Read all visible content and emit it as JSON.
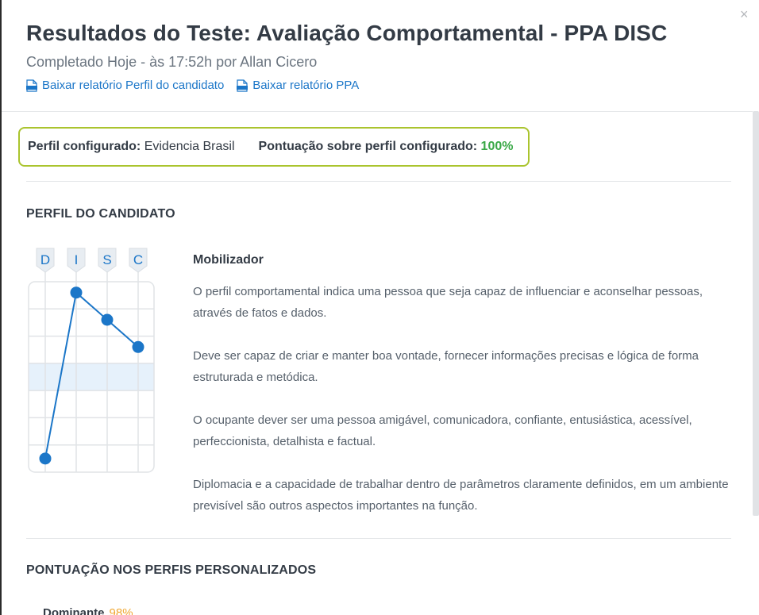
{
  "modal": {
    "close_icon": "×",
    "title": "Resultados do Teste: Avaliação Comportamental - PPA DISC",
    "subtitle": "Completado Hoje - às 17:52h por Allan Cicero",
    "links": [
      {
        "label": "Baixar relatório Perfil do candidato",
        "icon": "pdf-icon"
      },
      {
        "label": "Baixar relatório PPA",
        "icon": "pdf-icon"
      }
    ]
  },
  "profile_config": {
    "label": "Perfil configurado:",
    "value": "Evidencia Brasil",
    "score_label": "Pontuação sobre perfil configurado:",
    "score_value": "100%",
    "score_color": "#39a846"
  },
  "candidate_section": {
    "title": "PERFIL DO CANDIDATO",
    "profile_name": "Mobilizador",
    "paragraphs": [
      "O perfil comportamental indica uma pessoa que seja capaz de influenciar e aconselhar pessoas, através de fatos e dados.",
      "Deve ser capaz de criar e manter boa vontade, fornecer informações precisas e lógica de forma estruturada e metódica.",
      "O ocupante dever ser uma pessoa amigável, comunicadora, confiante, entusiástica, acessível, perfeccionista, detalhista e factual.",
      "Diplomacia e a capacidade de trabalhar dentro de parâmetros claramente definidos, em um ambiente previsível são outros aspectos importantes na função."
    ]
  },
  "chart_data": {
    "type": "line",
    "categories": [
      "D",
      "I",
      "S",
      "C"
    ],
    "values": [
      0.5,
      6.6,
      5.6,
      4.6
    ],
    "ylim": [
      0,
      7
    ],
    "highlight_band": [
      3,
      4
    ],
    "grid": true,
    "line_color": "#1b76c8",
    "band_color": "#e6f1fb"
  },
  "custom_section": {
    "title": "PONTUAÇÃO NOS PERFIS PERSONALIZADOS",
    "first_row_label": "Dominante",
    "first_row_pct": "98%"
  }
}
